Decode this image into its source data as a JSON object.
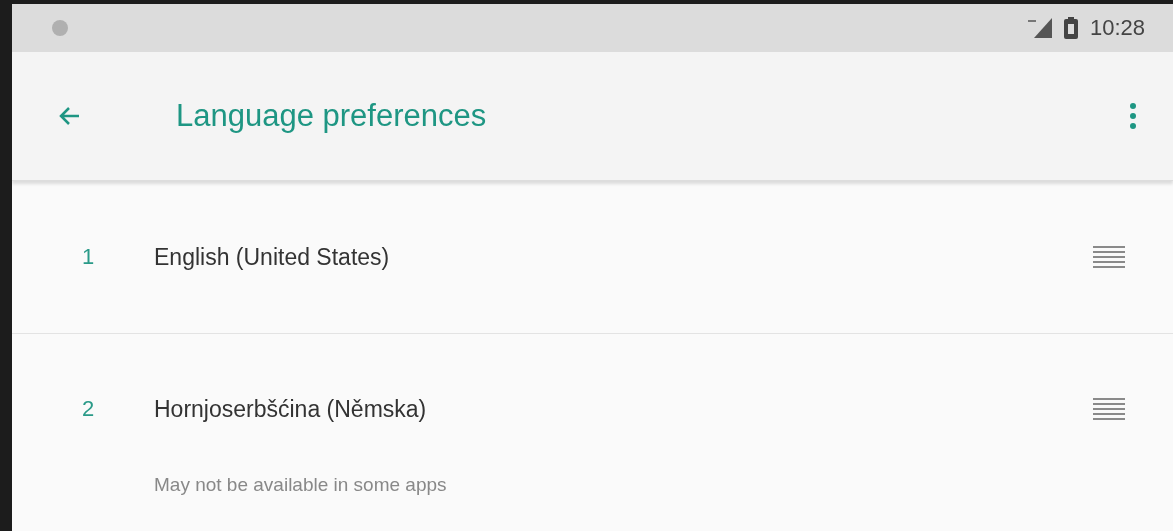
{
  "status_bar": {
    "time": "10:28"
  },
  "app_bar": {
    "title": "Language preferences"
  },
  "languages": [
    {
      "number": "1",
      "name": "English (United States)"
    },
    {
      "number": "2",
      "name": "Hornjoserbšćina (Němska)",
      "note": "May not be available in some apps"
    }
  ]
}
